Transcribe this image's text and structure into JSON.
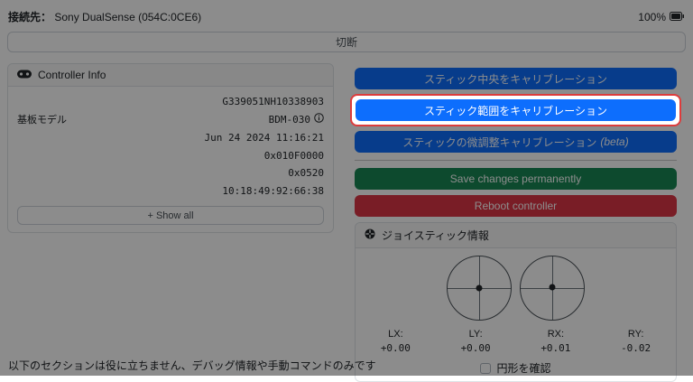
{
  "header": {
    "connection_label": "接続先：",
    "device_name": "Sony DualSense (054C:0CE6)",
    "battery_percent": "100%",
    "disconnect_label": "切断"
  },
  "controller_info": {
    "title": "Controller Info",
    "rows": [
      {
        "label": "",
        "value": "G339051NH10338903"
      },
      {
        "label": "基板モデル",
        "value": "BDM-030"
      },
      {
        "label": "",
        "value": "Jun 24 2024 11:16:21"
      },
      {
        "label": "",
        "value": "0x010F0000"
      },
      {
        "label": "",
        "value": "0x0520"
      },
      {
        "label": "",
        "value": "10:18:49:92:66:38"
      }
    ],
    "show_all_label": "+ Show all"
  },
  "actions": {
    "calibrate_center_label": "スティック中央をキャリブレーション",
    "calibrate_range_label": "スティック範囲をキャリブレーション",
    "calibrate_fine_label": "スティックの微調整キャリブレーション",
    "calibrate_fine_beta": "(beta)",
    "save_label": "Save changes permanently",
    "reboot_label": "Reboot controller"
  },
  "joystick_info": {
    "title": "ジョイスティック情報",
    "axes": [
      {
        "label": "LX:",
        "value": "+0.00"
      },
      {
        "label": "LY:",
        "value": "+0.00"
      },
      {
        "label": "RX:",
        "value": "+0.01"
      },
      {
        "label": "RY:",
        "value": "-0.02"
      }
    ],
    "circularity_label": "円形を確認"
  },
  "footer": {
    "note": "以下のセクションは役に立ちません、デバッグ情報や手動コマンドのみです"
  },
  "colors": {
    "primary": "#0d6efd",
    "success": "#198754",
    "danger": "#dc3545",
    "highlight_border": "#dd3c3c",
    "dim_overlay": "rgba(0,0,0,0.45)"
  }
}
